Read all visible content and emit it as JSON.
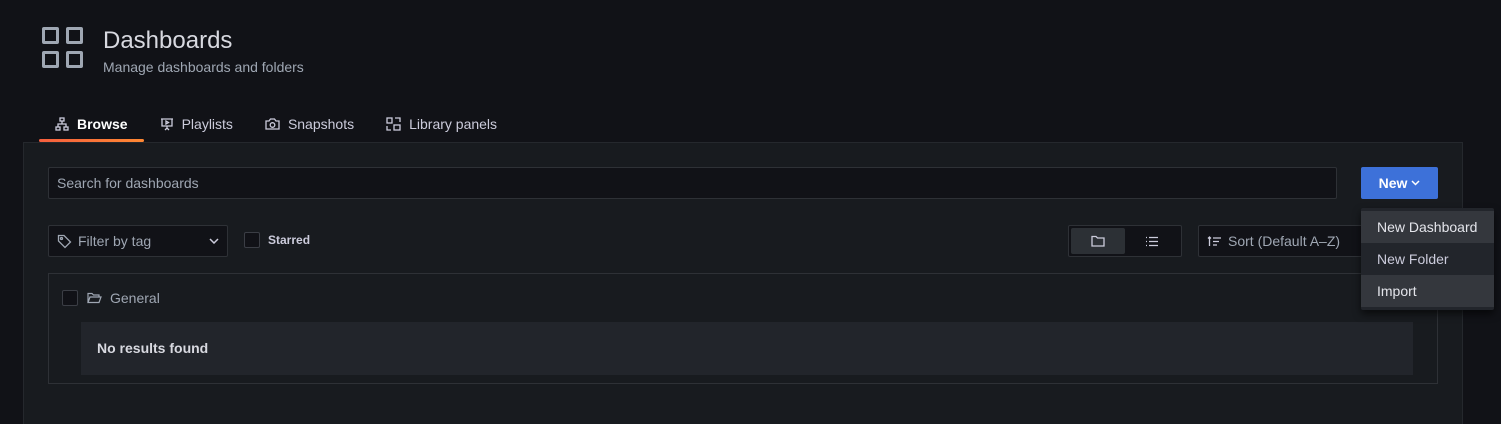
{
  "header": {
    "title": "Dashboards",
    "subtitle": "Manage dashboards and folders",
    "icon": "apps-grid-icon"
  },
  "tabs": [
    {
      "label": "Browse",
      "icon": "sitemap-icon",
      "active": true
    },
    {
      "label": "Playlists",
      "icon": "presentation-play-icon",
      "active": false
    },
    {
      "label": "Snapshots",
      "icon": "camera-icon",
      "active": false
    },
    {
      "label": "Library panels",
      "icon": "library-panel-icon",
      "active": false
    }
  ],
  "search": {
    "placeholder": "Search for dashboards",
    "value": ""
  },
  "new_button": {
    "label": "New"
  },
  "filters": {
    "tag_placeholder": "Filter by tag",
    "starred_label": "Starred",
    "starred_checked": false,
    "sort_label": "Sort (Default A–Z)",
    "view_mode": "folders"
  },
  "results": {
    "folder_name": "General",
    "empty_message": "No results found"
  },
  "new_menu": {
    "items": [
      "New Dashboard",
      "New Folder",
      "Import"
    ]
  },
  "colors": {
    "background": "#111217",
    "panel": "#181b1f",
    "primary": "#3d71d9",
    "tab_underline": "#f55f3e"
  }
}
